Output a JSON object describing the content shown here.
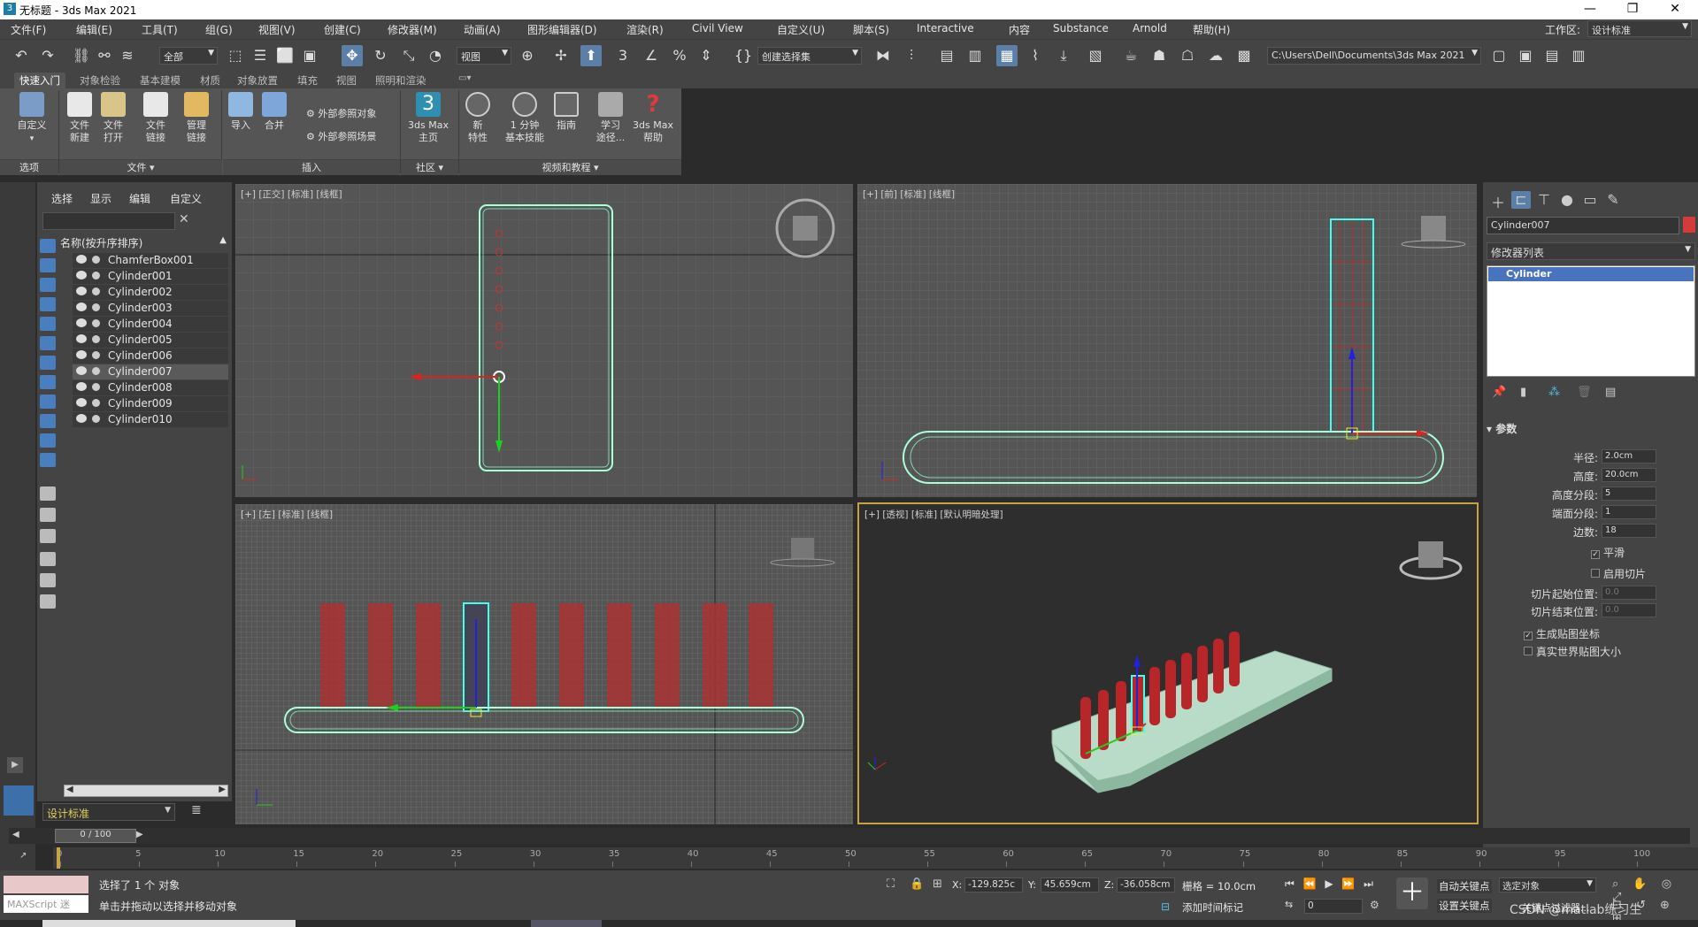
{
  "title": {
    "text": "无标题 - 3ds Max 2021",
    "app_icon": "3"
  },
  "window_controls": {
    "minimize": "—",
    "restore": "❐",
    "close": "✕"
  },
  "menu": {
    "items": [
      "文件(F)",
      "编辑(E)",
      "工具(T)",
      "组(G)",
      "视图(V)",
      "创建(C)",
      "修改器(M)",
      "动画(A)",
      "图形编辑器(D)",
      "渲染(R)",
      "Civil View",
      "自定义(U)",
      "脚本(S)",
      "Interactive",
      "内容",
      "Substance",
      "Arnold",
      "帮助(H)"
    ],
    "workspace_label": "工作区:",
    "workspace_value": "设计标准"
  },
  "toolbar": {
    "filter": "全部",
    "view": "视图",
    "selset": "创建选择集",
    "path": "C:\\Users\\Dell\\Documents\\3ds Max 2021"
  },
  "ribbon": {
    "tabs": [
      "快速入门",
      "对象检验",
      "基本建模",
      "材质",
      "对象放置",
      "填充",
      "视图",
      "照明和渲染"
    ],
    "buttons": [
      {
        "l1": "自定义",
        "l2": ""
      },
      {
        "l1": "文件",
        "l2": "新建"
      },
      {
        "l1": "文件",
        "l2": "打开"
      },
      {
        "l1": "文件",
        "l2": "链接"
      },
      {
        "l1": "管理",
        "l2": "链接"
      },
      {
        "l1": "导入",
        "l2": ""
      },
      {
        "l1": "合并",
        "l2": ""
      },
      {
        "l1": "3ds Max",
        "l2": "主页"
      },
      {
        "l1": "新",
        "l2": "特性"
      },
      {
        "l1": "1 分钟",
        "l2": "基本技能"
      },
      {
        "l1": "指南",
        "l2": ""
      },
      {
        "l1": "学习",
        "l2": "途径..."
      },
      {
        "l1": "3ds Max",
        "l2": "帮助"
      }
    ],
    "ext_ref_obj": "外部参照对象",
    "ext_ref_scene": "外部参照场景",
    "groups": [
      "选项",
      "文件 ▾",
      "插入",
      "社区 ▾",
      "视频和教程 ▾"
    ]
  },
  "explorer": {
    "tabs": [
      "选择",
      "显示",
      "编辑",
      "自定义"
    ],
    "header": "名称(按升序排序)",
    "rows": [
      "ChamferBox001",
      "Cylinder001",
      "Cylinder002",
      "Cylinder003",
      "Cylinder004",
      "Cylinder005",
      "Cylinder006",
      "Cylinder007",
      "Cylinder008",
      "Cylinder009",
      "Cylinder010"
    ],
    "selected_index": 7,
    "workspace": "设计标准"
  },
  "viewports": {
    "top": "[+] [正交] [标准] [线框]",
    "front": "[+] [前] [标准] [线框]",
    "left": "[+] [左] [标准] [线框]",
    "persp": "[+] [透视] [标准] [默认明暗处理]"
  },
  "command": {
    "object_name": "Cylinder007",
    "modifier_list": "修改器列表",
    "stack_item": "Cylinder",
    "rollout": "参数",
    "params": [
      {
        "label": "半径:",
        "value": "2.0cm",
        "disabled": false
      },
      {
        "label": "高度:",
        "value": "20.0cm",
        "disabled": false
      },
      {
        "label": "高度分段:",
        "value": "5",
        "disabled": false
      },
      {
        "label": "端面分段:",
        "value": "1",
        "disabled": false
      },
      {
        "label": "边数:",
        "value": "18",
        "disabled": false
      }
    ],
    "smooth": "平滑",
    "slice_on": "启用切片",
    "slice_from": {
      "label": "切片起始位置:",
      "value": "0.0"
    },
    "slice_to": {
      "label": "切片结束位置:",
      "value": "0.0"
    },
    "gen_map": "生成贴图坐标",
    "real_world": "真实世界贴图大小",
    "object_color": "#d43c3c"
  },
  "timeline": {
    "frame": "0 / 100",
    "ticks": [
      "0",
      "5",
      "10",
      "15",
      "20",
      "25",
      "30",
      "35",
      "40",
      "45",
      "50",
      "55",
      "60",
      "65",
      "70",
      "75",
      "80",
      "85",
      "90",
      "95",
      "100"
    ]
  },
  "status": {
    "maxscript": "MAXScript 迷",
    "selected": "选择了 1 个 对象",
    "prompt": "单击并拖动以选择并移动对象",
    "x_label": "X:",
    "x": "-129.825c",
    "y_label": "Y:",
    "y": "45.659cm",
    "z_label": "Z:",
    "z": "-36.058cm",
    "grid": "栅格 = 10.0cm",
    "add_time_tag": "添加时间标记",
    "auto_key": "自动关键点",
    "set_key": "设置关键点",
    "sel_obj": "选定对象",
    "key_filter": "关键点过滤器...",
    "frame_field": "0",
    "watermark": "CSDN @matlab练习生"
  }
}
